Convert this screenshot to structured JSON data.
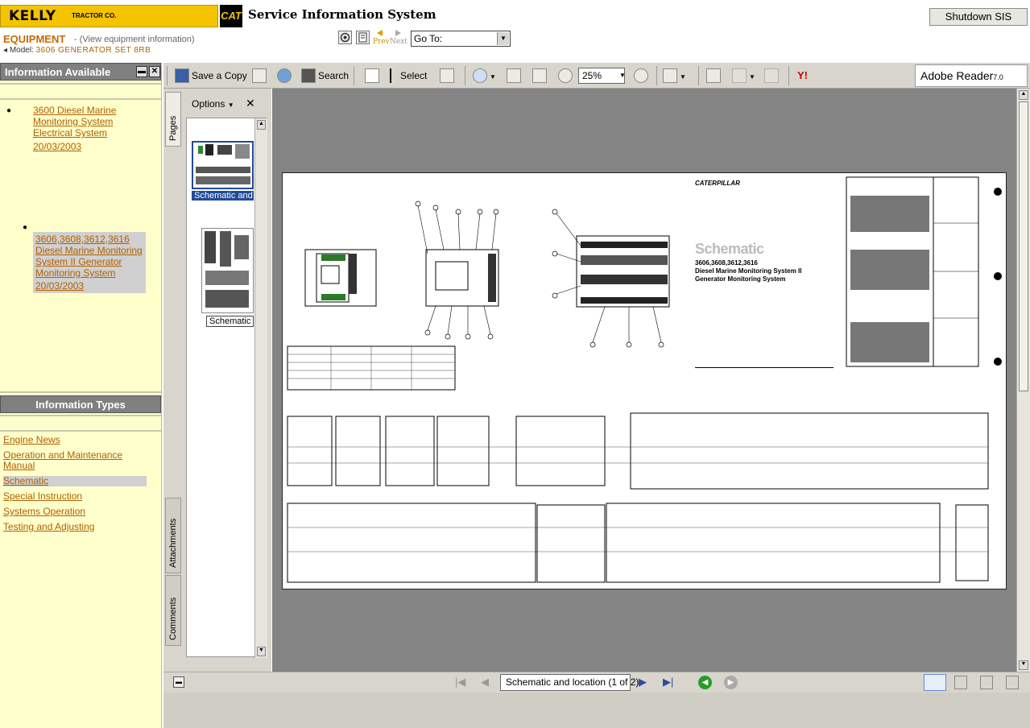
{
  "header": {
    "brand_name": "KELLY",
    "brand_sub": "TRACTOR CO.",
    "cat_logo": "CAT",
    "system_title": "Service Information System",
    "shutdown_label": "Shutdown SIS",
    "equipment_label": "EQUIPMENT",
    "equipment_sub": "- (View equipment information)",
    "model_label": "Model:",
    "model_value": "3606 GENERATOR SET 8RB",
    "prev_label": "Prev",
    "next_label": "Next",
    "goto_label": "Go To:"
  },
  "left_panel": {
    "info_available_title": "Information Available",
    "documents": [
      {
        "title": "3600 Diesel Marine Monitoring System Electrical System",
        "date": "20/03/2003"
      },
      {
        "title": "3606,3608,3612,3616 Diesel Marine Monitoring System II Generator Monitoring System",
        "date": "20/03/2003"
      }
    ],
    "info_types_title": "Information Types",
    "types": [
      "Engine News",
      "Operation and Maintenance Manual",
      "Schematic",
      "Special Instruction",
      "Systems Operation",
      "Testing and Adjusting"
    ],
    "selected_type": "Schematic"
  },
  "toolbar": {
    "save_copy": "Save a Copy",
    "search": "Search",
    "select": "Select",
    "zoom": "25%",
    "adobe_label": "Adobe Reader",
    "adobe_version": "7.0"
  },
  "nav_pane": {
    "options": "Options",
    "close": "✕",
    "tab_pages": "Pages",
    "tab_attachments": "Attachments",
    "tab_comments": "Comments",
    "thumb1_label": "Schematic and",
    "thumb2_label": "Schematic"
  },
  "document": {
    "company": "CATERPILLAR",
    "title": "Schematic",
    "models": "3606,3608,3612,3616",
    "line1": "Diesel Marine Monitoring System II",
    "line2": "Generator Monitoring System"
  },
  "bottom_bar": {
    "page_indicator": "Schematic and location  (1 of 2)"
  },
  "colors": {
    "brand_yellow": "#f5c400",
    "link": "#b06000",
    "left_panel_bg": "#ffffcc",
    "toolbar_bg": "#d8d5cc"
  }
}
